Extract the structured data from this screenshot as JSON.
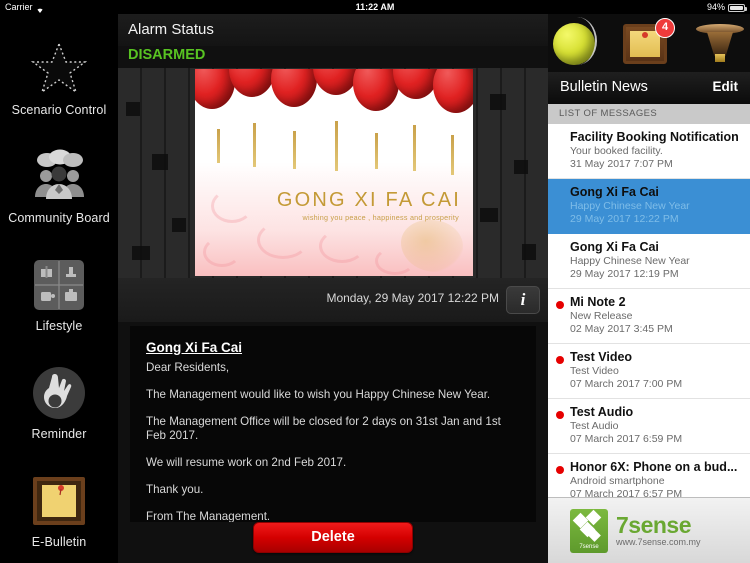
{
  "status_bar": {
    "carrier": "Carrier",
    "time": "11:22 AM",
    "battery": "94%"
  },
  "sidebar": {
    "items": [
      {
        "label": "Scenario Control",
        "icon": "star-icon"
      },
      {
        "label": "Community Board",
        "icon": "people-speech-icon"
      },
      {
        "label": "Lifestyle",
        "icon": "grid-icon"
      },
      {
        "label": "Reminder",
        "icon": "ok-hand-icon"
      },
      {
        "label": "E-Bulletin",
        "icon": "corkboard-note-icon"
      }
    ]
  },
  "alarm": {
    "title": "Alarm Status",
    "state": "DISARMED",
    "state_color": "#58c322"
  },
  "top_icons": {
    "ball": "tennis-ball-icon",
    "board": "bulletin-board-icon",
    "badge_count": "4",
    "siren": "siren-icon"
  },
  "banner": {
    "title": "GONG XI FA CAI",
    "subtitle": "wishing you peace , happiness and prosperity"
  },
  "date_bar": {
    "date": "Monday, 29 May 2017 12:22 PM",
    "info_label": "i"
  },
  "message": {
    "title": "Gong Xi Fa Cai",
    "lines": [
      "Dear Residents,",
      "The Management would like to wish you Happy Chinese New Year.",
      "The Management Office will be closed for 2 days on 31st Jan and 1st Feb 2017.",
      "We will resume work on 2nd Feb 2017.",
      "Thank you.",
      "From The Management."
    ]
  },
  "delete_button": {
    "label": "Delete",
    "color": "#d40000"
  },
  "bulletin": {
    "title": "Bulletin News",
    "edit_label": "Edit",
    "section_header": "LIST OF MESSAGES",
    "messages": [
      {
        "title": "Facility Booking Notification",
        "subtitle": "Your booked facility.",
        "date": "31 May 2017 7:07 PM",
        "unread": false,
        "selected": false
      },
      {
        "title": "Gong Xi Fa Cai",
        "subtitle": "Happy Chinese New Year",
        "date": "29 May 2017 12:22 PM",
        "unread": false,
        "selected": true
      },
      {
        "title": "Gong Xi Fa Cai",
        "subtitle": "Happy Chinese New Year",
        "date": "29 May 2017 12:19 PM",
        "unread": false,
        "selected": false
      },
      {
        "title": "Mi Note 2",
        "subtitle": "New Release",
        "date": "02 May 2017 3:45 PM",
        "unread": true,
        "selected": false
      },
      {
        "title": "Test Video",
        "subtitle": "Test Video",
        "date": "07 March 2017 7:00 PM",
        "unread": true,
        "selected": false
      },
      {
        "title": "Test Audio",
        "subtitle": "Test Audio",
        "date": "07 March 2017 6:59 PM",
        "unread": true,
        "selected": false
      },
      {
        "title": "Honor 6X: Phone on a bud...",
        "subtitle": "Android smartphone",
        "date": "07 March 2017 6:57 PM",
        "unread": true,
        "selected": false
      }
    ]
  },
  "ad": {
    "brand": "7sense",
    "logo_caption": "7sense",
    "url": "www.7sense.com.my"
  }
}
